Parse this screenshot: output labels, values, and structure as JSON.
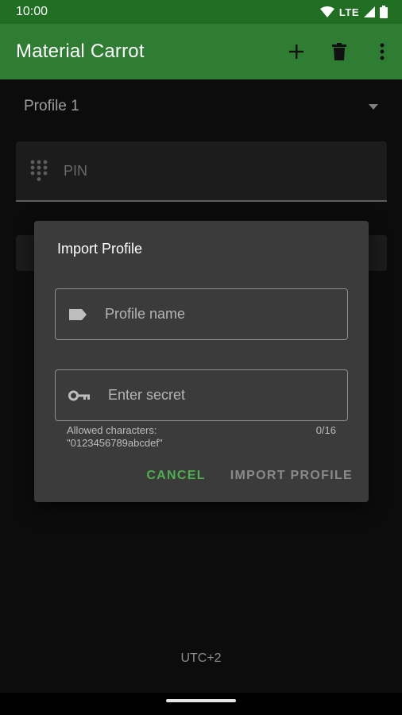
{
  "status_bar": {
    "time": "10:00",
    "network": "LTE",
    "icons": [
      "wifi-icon",
      "signal-icon",
      "battery-icon"
    ]
  },
  "app_bar": {
    "title": "Material Carrot",
    "actions": [
      "add-icon",
      "delete-icon",
      "more-vert-icon"
    ]
  },
  "main": {
    "profile_selected": "Profile 1",
    "pin_placeholder": "PIN",
    "timezone": "UTC+2"
  },
  "dialog": {
    "title": "Import Profile",
    "name_placeholder": "Profile name",
    "secret_placeholder": "Enter secret",
    "helper_line1": "Allowed characters:",
    "helper_line2": "\"0123456789abcdef\"",
    "counter": "0/16",
    "cancel_label": "CANCEL",
    "import_label": "IMPORT PROFILE"
  },
  "colors": {
    "status_bar": "#1f6e22",
    "app_bar": "#2e7d32",
    "accent": "#4caf50",
    "dialog": "#3b3b3b",
    "background": "#121212"
  }
}
